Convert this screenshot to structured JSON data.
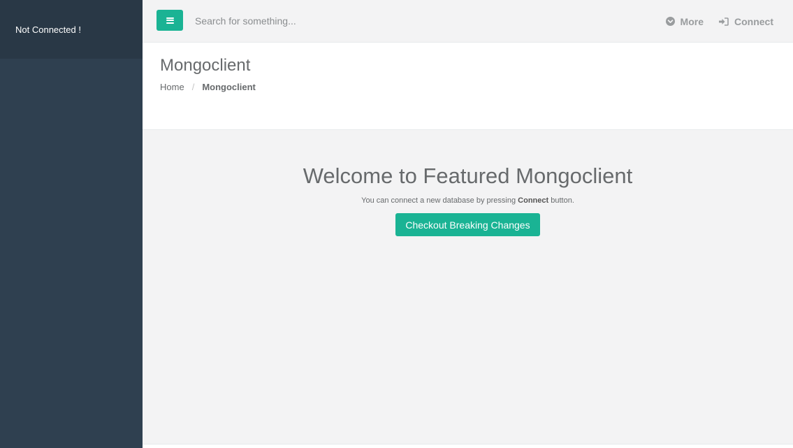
{
  "sidebar": {
    "status": "Not Connected !"
  },
  "navbar": {
    "menu_icon": "bars-icon",
    "search": {
      "placeholder": "Search for something...",
      "value": ""
    },
    "more": {
      "label": "More",
      "icon": "chevron-circle-down-icon"
    },
    "connect": {
      "label": "Connect",
      "icon": "sign-in-icon"
    }
  },
  "page_heading": {
    "title": "Mongoclient",
    "breadcrumb": [
      {
        "label": "Home"
      },
      {
        "label": "Mongoclient"
      }
    ]
  },
  "welcome": {
    "title": "Welcome to Featured Mongoclient",
    "text_before": "You can connect a new database by pressing",
    "text_bold": "Connect",
    "text_after": "button.",
    "button_label": "Checkout Breaking Changes"
  },
  "colors": {
    "sidebar_bg": "#2f4050",
    "accent": "#1ab394",
    "page_bg": "#f3f3f4"
  }
}
